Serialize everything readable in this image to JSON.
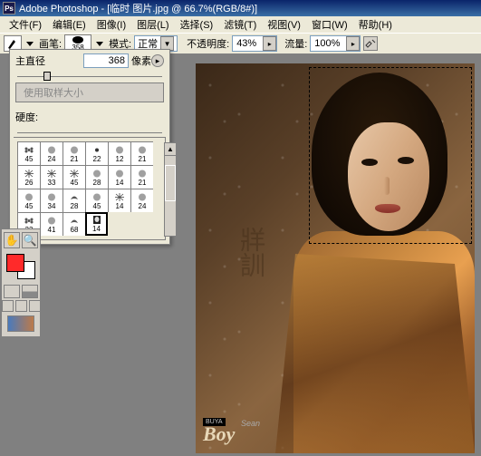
{
  "title": "Adobe Photoshop - [临时 图片.jpg @ 66.7%(RGB/8#)]",
  "menus": [
    "文件(F)",
    "编辑(E)",
    "图像(I)",
    "图层(L)",
    "选择(S)",
    "滤镜(T)",
    "视图(V)",
    "窗口(W)",
    "帮助(H)"
  ],
  "options": {
    "brush_label": "画笔:",
    "brush_size_display": "358",
    "mode_label": "模式:",
    "mode_value": "正常",
    "opacity_label": "不透明度:",
    "opacity_value": "43%",
    "flow_label": "流量:",
    "flow_value": "100%"
  },
  "panel": {
    "diameter_label": "主直径",
    "diameter_value": "368",
    "diameter_unit": "像素",
    "sample_btn": "使用取样大小",
    "hardness_label": "硬度:"
  },
  "brushes": [
    {
      "s": 45,
      "t": "flower"
    },
    {
      "s": 24,
      "t": "stamp"
    },
    {
      "s": 21,
      "t": "stamp"
    },
    {
      "s": 22,
      "t": "dot"
    },
    {
      "s": 12,
      "t": "stamp"
    },
    {
      "s": 21,
      "t": "stamp"
    },
    {
      "s": 26,
      "t": "burst"
    },
    {
      "s": 33,
      "t": "burst"
    },
    {
      "s": 45,
      "t": "burst"
    },
    {
      "s": 28,
      "t": "stamp"
    },
    {
      "s": 14,
      "t": "stamp"
    },
    {
      "s": 21,
      "t": "stamp"
    },
    {
      "s": 45,
      "t": "stamp"
    },
    {
      "s": 34,
      "t": "stamp"
    },
    {
      "s": 28,
      "t": "leaf"
    },
    {
      "s": 45,
      "t": "stamp"
    },
    {
      "s": 14,
      "t": "burst"
    },
    {
      "s": 24,
      "t": "stamp"
    },
    {
      "s": 33,
      "t": "flower"
    },
    {
      "s": 41,
      "t": "stamp"
    },
    {
      "s": 68,
      "t": "leaf"
    },
    {
      "s": 14,
      "t": "face",
      "sel": true
    }
  ],
  "swatch": {
    "fg": "#ff2a2a",
    "bg": "#ffffff"
  },
  "watermark": {
    "tag": "BUYA",
    "main": "Boy",
    "small": "Sean"
  },
  "chinese_deco": "牂訓"
}
